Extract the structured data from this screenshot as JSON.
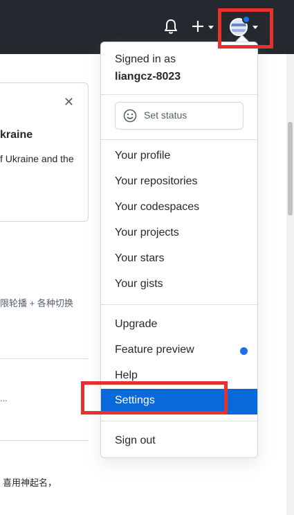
{
  "background": {
    "card_title": "kraine",
    "card_text": "f Ukraine and the",
    "text2": "限轮播 + 各种切换",
    "text3": "...",
    "text4": "喜用神起名，"
  },
  "menu": {
    "signed_in_label": "Signed in as",
    "username": "liangcz-8023",
    "status_button": "Set status",
    "items_group1": [
      "Your profile",
      "Your repositories",
      "Your codespaces",
      "Your projects",
      "Your stars",
      "Your gists"
    ],
    "items_group2": [
      "Upgrade",
      "Feature preview",
      "Help",
      "Settings"
    ],
    "sign_out": "Sign out"
  },
  "colors": {
    "header_bg": "#24292f",
    "accent": "#0969da",
    "highlight": "#e5322d",
    "notification_dot": "#1f6feb"
  },
  "icons": [
    "bell-icon",
    "plus-icon",
    "caret-down-icon",
    "avatar",
    "smiley-icon",
    "close-icon"
  ]
}
